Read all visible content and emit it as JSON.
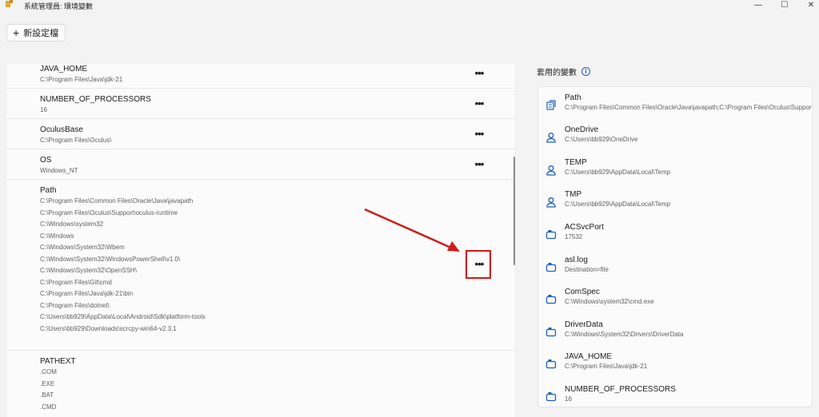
{
  "window": {
    "title": "系統管理員: 環境變數",
    "minimize_glyph": "—",
    "maximize_glyph": "☐",
    "close_glyph": "✕",
    "app_icon": "tool-icon"
  },
  "toolbar": {
    "new_button_icon": "+",
    "new_button_label": "新設定檔"
  },
  "variables": [
    {
      "name": "JAVA_HOME",
      "values": [
        "C:\\Program Files\\Java\\jdk-21"
      ]
    },
    {
      "name": "NUMBER_OF_PROCESSORS",
      "values": [
        "16"
      ]
    },
    {
      "name": "OculusBase",
      "values": [
        "C:\\Program Files\\Oculus\\"
      ]
    },
    {
      "name": "OS",
      "values": [
        "Windows_NT"
      ]
    },
    {
      "name": "Path",
      "values": [
        "C:\\Program Files\\Common Files\\Oracle\\Java\\javapath",
        "C:\\Program Files\\Oculus\\Support\\oculus-runtime",
        "C:\\Windows\\system32",
        "C:\\Windows",
        "C:\\Windows\\System32\\Wbem",
        "C:\\Windows\\System32\\WindowsPowerShell\\v1.0\\",
        "C:\\Windows\\System32\\OpenSSH\\",
        "C:\\Program Files\\Git\\cmd",
        "C:\\Program Files\\Java\\jdk-21\\bin",
        "C:\\Program Files\\dotnet\\",
        "C:\\Users\\bb929\\AppData\\Local\\Android\\Sdk\\platform-tools",
        "C:\\Users\\bb929\\Downloads\\scrcpy-win64-v2.3.1"
      ]
    },
    {
      "name": "PATHEXT",
      "values": [
        ".COM",
        ".EXE",
        ".BAT",
        ".CMD"
      ]
    }
  ],
  "more_glyph": "•••",
  "applied": {
    "title": "套用的變數",
    "info_glyph": "i",
    "items": [
      {
        "name": "Path",
        "value": "C:\\Program Files\\Common Files\\Oracle\\Java\\javapath;C:\\Program Files\\Oculus\\Support\\oculus-runtime",
        "icon": "path-icon"
      },
      {
        "name": "OneDrive",
        "value": "C:\\Users\\bb929\\OneDrive",
        "icon": "user-icon"
      },
      {
        "name": "TEMP",
        "value": "C:\\Users\\bb929\\AppData\\Local\\Temp",
        "icon": "user-icon"
      },
      {
        "name": "TMP",
        "value": "C:\\Users\\bb929\\AppData\\Local\\Temp",
        "icon": "user-icon"
      },
      {
        "name": "ACSvcPort",
        "value": "17532",
        "icon": "system-icon"
      },
      {
        "name": "asl.log",
        "value": "Destination=file",
        "icon": "system-icon"
      },
      {
        "name": "ComSpec",
        "value": "C:\\Windows\\system32\\cmd.exe",
        "icon": "system-icon"
      },
      {
        "name": "DriverData",
        "value": "C:\\Windows\\System32\\Drivers\\DriverData",
        "icon": "system-icon"
      },
      {
        "name": "JAVA_HOME",
        "value": "C:\\Program Files\\Java\\jdk-21",
        "icon": "system-icon"
      },
      {
        "name": "NUMBER_OF_PROCESSORS",
        "value": "16",
        "icon": "system-icon"
      }
    ]
  },
  "colors": {
    "annotation": "#d11a1a",
    "accent": "#1e5fb8"
  }
}
